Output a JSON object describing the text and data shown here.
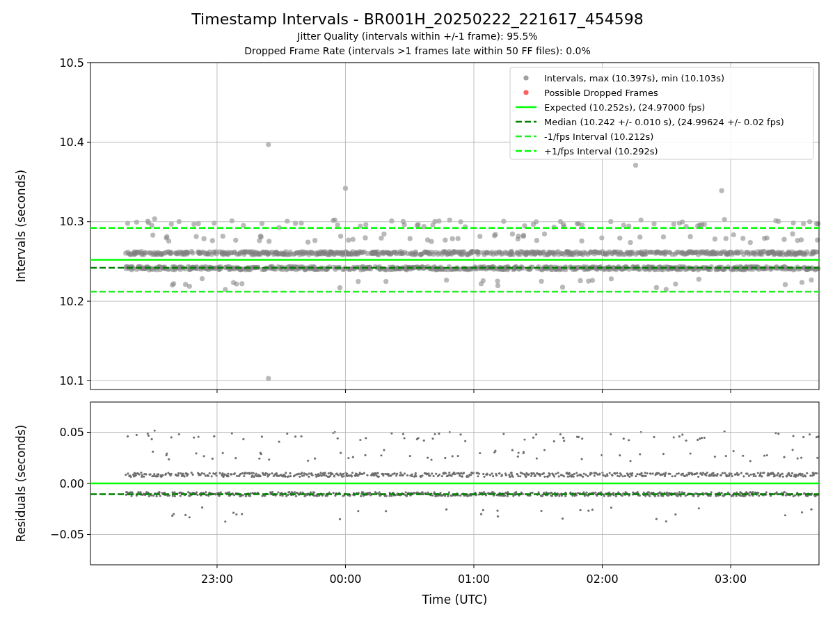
{
  "figure": {
    "title": "Timestamp Intervals - BR001H_20250222_221617_454598",
    "subtitles": [
      "Jitter Quality (intervals within +/-1 frame): 95.5%",
      "Dropped Frame Rate (intervals >1 frames late within 50 FF files): 0.0%"
    ]
  },
  "intervals_panel": {
    "legend_markers": [
      {
        "label": "Intervals, max (10.397s), min (10.103s)",
        "color": "#a0a0a0"
      },
      {
        "label": "Possible Dropped Frames",
        "color": "#ff6060"
      }
    ],
    "chart_data": {
      "type": "line",
      "ylabel": "Intervals (seconds)",
      "categories": [
        null,
        null
      ],
      "ylim": [
        10.089,
        10.5
      ],
      "grid": true,
      "legend": "upper right",
      "yticks": [
        {
          "value": 10.1,
          "label": "10.1"
        },
        {
          "value": 10.2,
          "label": "10.2"
        },
        {
          "value": 10.3,
          "label": "10.3"
        },
        {
          "value": 10.4,
          "label": "10.4"
        },
        {
          "value": 10.5,
          "label": "10.5"
        }
      ],
      "ref_lines": [
        {
          "axis": "y",
          "value": 10.252,
          "label": "Expected (10.252s), (24.97000 fps)",
          "color": "#00ff00",
          "line_style": "solid"
        },
        {
          "axis": "y",
          "value": 10.242,
          "label": "Median (10.242 +/- 0.010 s), (24.99624 +/- 0.02 fps)",
          "color": "#008000",
          "line_style": "dashed"
        },
        {
          "axis": "y",
          "value": 10.212,
          "label": "-1/fps Interval (10.212s)",
          "color": "#22ee22",
          "line_style": "dashed"
        },
        {
          "axis": "y",
          "value": 10.292,
          "label": "+1/fps Interval (10.292s)",
          "color": "#00ff00",
          "line_style": "dashed"
        }
      ]
    }
  },
  "residuals_panel": {
    "time_labels": [
      "23:00",
      "00:00",
      "01:00",
      "02:00",
      "03:00"
    ],
    "chart_data": {
      "type": "line",
      "xlabel": "Time (UTC)",
      "ylabel": "Residuals (seconds)",
      "categories": [
        null,
        null
      ],
      "ylim": [
        -0.0796,
        0.0796
      ],
      "grid": true,
      "yticks": [
        {
          "value": 0.05,
          "label": "0.05"
        },
        {
          "value": 0,
          "label": "0.00"
        },
        {
          "value": -0.05,
          "label": "−0.05"
        }
      ],
      "ref_lines": [
        {
          "axis": "y",
          "value": 0,
          "color": "#00ff00",
          "line_style": "solid"
        },
        {
          "axis": "y",
          "value": -0.0105,
          "color": "#008000",
          "line_style": "dashed"
        }
      ]
    }
  }
}
